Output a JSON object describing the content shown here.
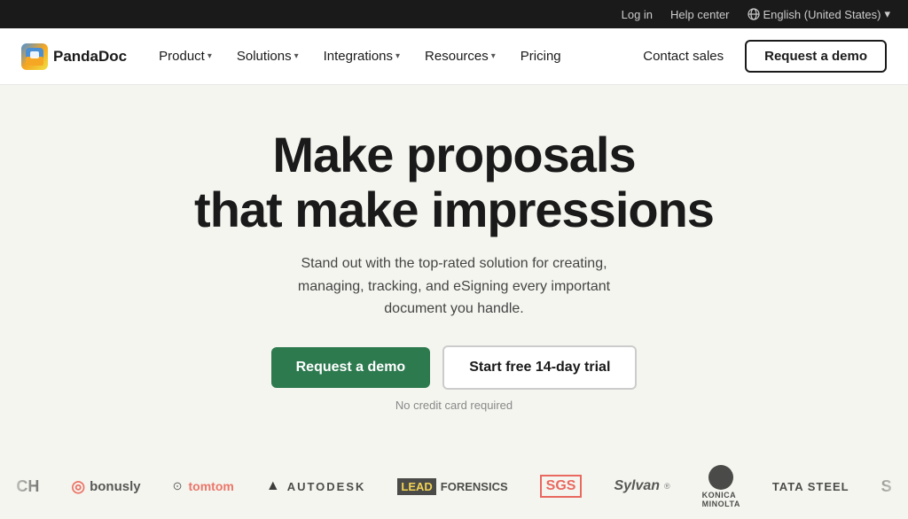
{
  "utility_bar": {
    "login": "Log in",
    "help_center": "Help center",
    "language": "English (United States)",
    "language_chevron": "▾"
  },
  "navbar": {
    "logo_text": "PandaDoc",
    "nav_items": [
      {
        "label": "Product",
        "has_dropdown": true
      },
      {
        "label": "Solutions",
        "has_dropdown": true
      },
      {
        "label": "Integrations",
        "has_dropdown": true
      },
      {
        "label": "Resources",
        "has_dropdown": true
      },
      {
        "label": "Pricing",
        "has_dropdown": false
      }
    ],
    "contact_sales": "Contact sales",
    "request_demo": "Request a demo"
  },
  "hero": {
    "title_line1": "Make proposals",
    "title_line2": "that make impressions",
    "subtitle": "Stand out with the top-rated solution for creating, managing, tracking, and eSigning every important document you handle.",
    "cta_primary": "Request a demo",
    "cta_secondary": "Start free 14-day trial",
    "no_credit": "No credit card required"
  },
  "logos": [
    {
      "name": "CH",
      "type": "partial-left"
    },
    {
      "name": "bonusly",
      "type": "bonusly"
    },
    {
      "name": "tomtom",
      "type": "tomtom"
    },
    {
      "name": "AUTODESK",
      "type": "autodesk"
    },
    {
      "name": "LEAD FORENSICS",
      "type": "lead-forensics"
    },
    {
      "name": "SGS",
      "type": "sgs"
    },
    {
      "name": "Sylvan",
      "type": "sylvan"
    },
    {
      "name": "Konica Minolta",
      "type": "konica"
    },
    {
      "name": "TATA STEEL",
      "type": "tata"
    },
    {
      "name": "S",
      "type": "partial-right"
    }
  ],
  "colors": {
    "primary_green": "#2d7a4f",
    "navbar_bg": "#ffffff",
    "hero_bg": "#f5f5f0",
    "utility_bg": "#1a1a1a",
    "text_dark": "#1a1a1a",
    "text_muted": "#888888"
  }
}
